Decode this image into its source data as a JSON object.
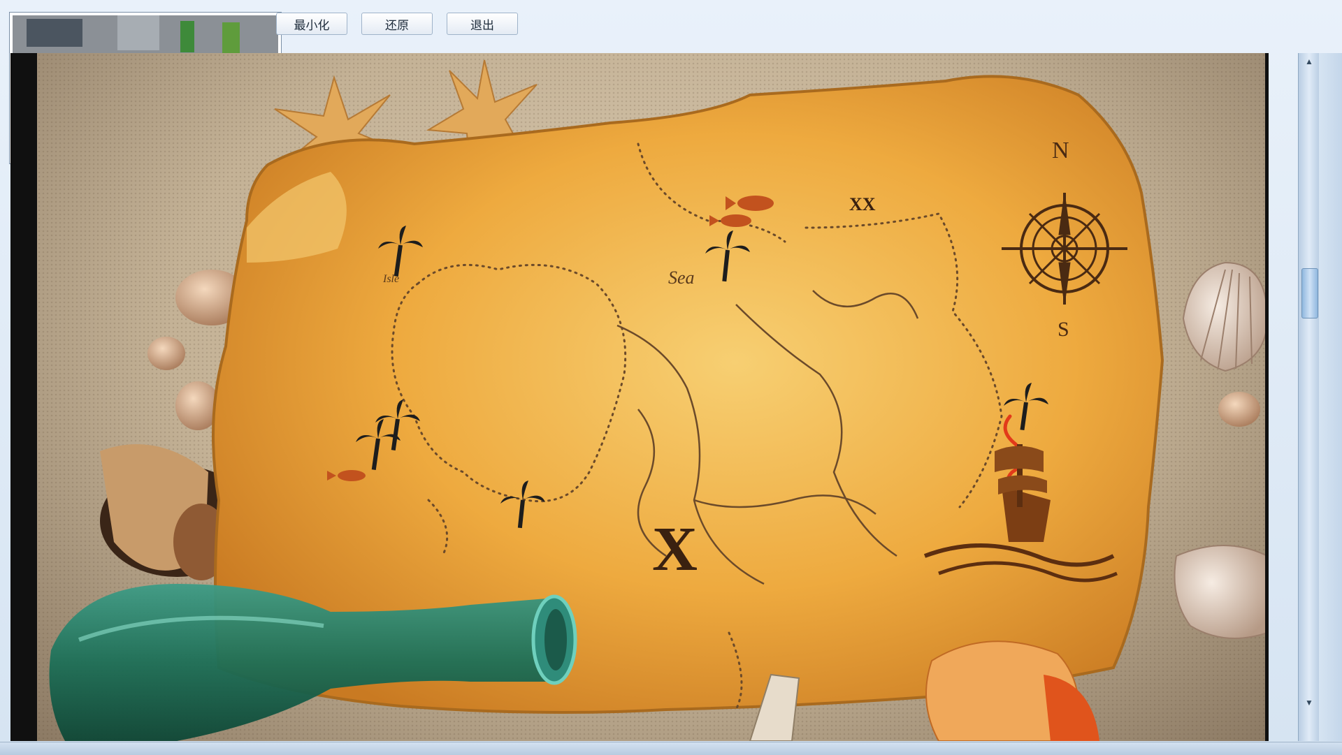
{
  "toolbar": {
    "minimize_label": "最小化",
    "restore_label": "还原",
    "exit_label": "退出"
  },
  "map": {
    "sea_label": "Sea",
    "isle_label": "Isle",
    "xx_label": "XX",
    "x_label": "X",
    "compass_n": "N",
    "compass_s": "S"
  },
  "icons": {
    "scroll_up": "▲",
    "scroll_down": "▼"
  }
}
